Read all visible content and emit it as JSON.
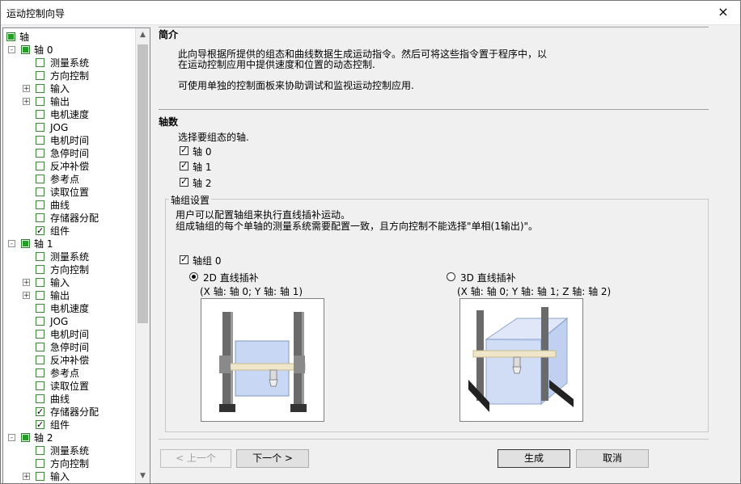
{
  "window": {
    "title": "运动控制向导",
    "close_icon": "×"
  },
  "tree": {
    "root": {
      "label": "轴"
    },
    "axes": [
      {
        "label": "轴 0",
        "items": [
          "测量系统",
          "方向控制",
          "输入",
          "输出",
          "电机速度",
          "JOG",
          "电机时间",
          "急停时间",
          "反冲补偿",
          "参考点",
          "读取位置",
          "曲线",
          "存储器分配",
          "组件"
        ]
      },
      {
        "label": "轴 1",
        "items": [
          "测量系统",
          "方向控制",
          "输入",
          "输出",
          "电机速度",
          "JOG",
          "电机时间",
          "急停时间",
          "反冲补偿",
          "参考点",
          "读取位置",
          "曲线",
          "存储器分配",
          "组件"
        ]
      },
      {
        "label": "轴 2",
        "items": [
          "测量系统",
          "方向控制",
          "输入"
        ]
      }
    ]
  },
  "intro": {
    "heading": "简介",
    "line1": "此向导根据所提供的组态和曲线数据生成运动指令。然后可将这些指令置于程序中，以",
    "line2": "在运动控制应用中提供速度和位置的动态控制.",
    "line3": "可使用单独的控制面板来协助调试和监视运动控制应用."
  },
  "axes_section": {
    "heading": "轴数",
    "prompt": "选择要组态的轴.",
    "axes": [
      {
        "label": "轴 0",
        "checked": true
      },
      {
        "label": "轴 1",
        "checked": true
      },
      {
        "label": "轴 2",
        "checked": true
      }
    ]
  },
  "group_settings": {
    "title": "轴组设置",
    "desc1": "用户可以配置轴组来执行直线插补运动。",
    "desc2": "组成轴组的每个单轴的测量系统需要配置一致，且方向控制不能选择\"单相(1输出)\"。",
    "group0": {
      "label": "轴组 0",
      "checked": true
    },
    "option_2d": {
      "label": "2D 直线插补",
      "detail": "(X 轴: 轴 0; Y 轴: 轴 1)",
      "selected": true
    },
    "option_3d": {
      "label": "3D 直线插补",
      "detail": "(X 轴: 轴 0; Y 轴: 轴 1; Z 轴: 轴 2)",
      "selected": false
    }
  },
  "buttons": {
    "prev": "< 上一个",
    "next": "下一个 >",
    "generate": "生成",
    "cancel": "取消"
  }
}
